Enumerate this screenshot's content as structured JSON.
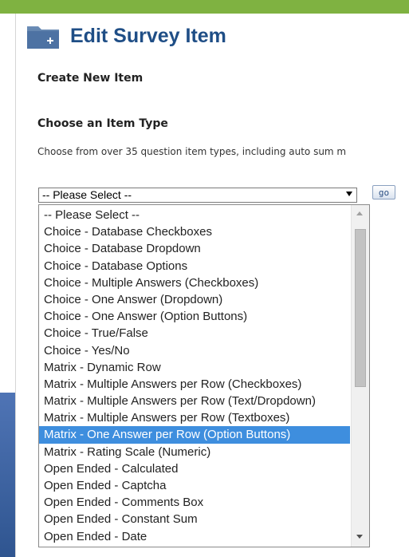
{
  "header": {
    "title": "Edit Survey Item",
    "icon": "folder-add-icon"
  },
  "section": {
    "title": "Create New Item"
  },
  "item_type": {
    "title": "Choose an Item Type",
    "description": "Choose from over 35 question item types, including auto sum m",
    "selected_label": "-- Please Select --",
    "go_label": "go"
  },
  "dropdown": {
    "highlighted": "Matrix - One Answer per Row (Option Buttons)",
    "options": [
      "-- Please Select --",
      "Choice - Database Checkboxes",
      "Choice - Database Dropdown",
      "Choice - Database Options",
      "Choice - Multiple Answers (Checkboxes)",
      "Choice - One Answer (Dropdown)",
      "Choice - One Answer (Option Buttons)",
      "Choice - True/False",
      "Choice - Yes/No",
      "Matrix - Dynamic Row",
      "Matrix - Multiple Answers per Row (Checkboxes)",
      "Matrix - Multiple Answers per Row (Text/Dropdown)",
      "Matrix - Multiple Answers per Row (Textboxes)",
      "Matrix - One Answer per Row (Option Buttons)",
      "Matrix - Rating Scale (Numeric)",
      "Open Ended - Calculated",
      "Open Ended - Captcha",
      "Open Ended - Comments Box",
      "Open Ended - Constant Sum",
      "Open Ended - Date"
    ]
  },
  "colors": {
    "accent": "#7fb241",
    "title": "#1f4e86",
    "highlight": "#3e8ede",
    "band": "#3a5f9e"
  }
}
